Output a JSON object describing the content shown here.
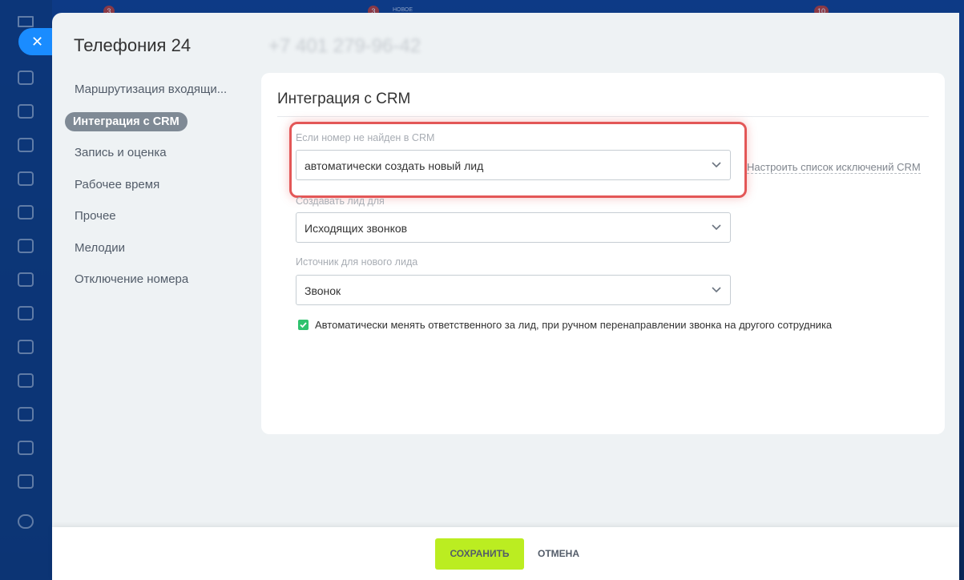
{
  "background": {
    "badges": [
      "3",
      "3",
      "10"
    ],
    "new_label": "НОВОЕ"
  },
  "panel": {
    "title": "Телефония 24",
    "phone": "+7 401 279-96-42"
  },
  "menu": {
    "items": [
      {
        "label": "Маршрутизация входящи..."
      },
      {
        "label": "Интеграция с CRM",
        "active": true
      },
      {
        "label": "Запись и оценка"
      },
      {
        "label": "Рабочее время"
      },
      {
        "label": "Прочее"
      },
      {
        "label": "Мелодии"
      },
      {
        "label": "Отключение номера"
      }
    ]
  },
  "crm": {
    "title": "Интеграция с CRM",
    "not_found_label": "Если номер не найден в CRM",
    "not_found_value": "автоматически создать новый лид",
    "exceptions_link": "Настроить список исключений CRM",
    "create_lead_for_label": "Создавать лид для",
    "create_lead_for_value": "Исходящих звонков",
    "lead_source_label": "Источник для нового лида",
    "lead_source_value": "Звонок",
    "auto_change_responsible_label": "Автоматически менять ответственного за лид, при ручном перенаправлении звонка на другого сотрудника",
    "auto_change_responsible_checked": true
  },
  "footer": {
    "save_label": "СОХРАНИТЬ",
    "cancel_label": "ОТМЕНА"
  },
  "colors": {
    "save_button": "#bbed21",
    "highlight": "#e35757",
    "checkbox": "#2fc26e",
    "close_button": "#1a8cff"
  },
  "icons": [
    "close-icon",
    "chevron-down-icon",
    "checkmark-icon"
  ]
}
